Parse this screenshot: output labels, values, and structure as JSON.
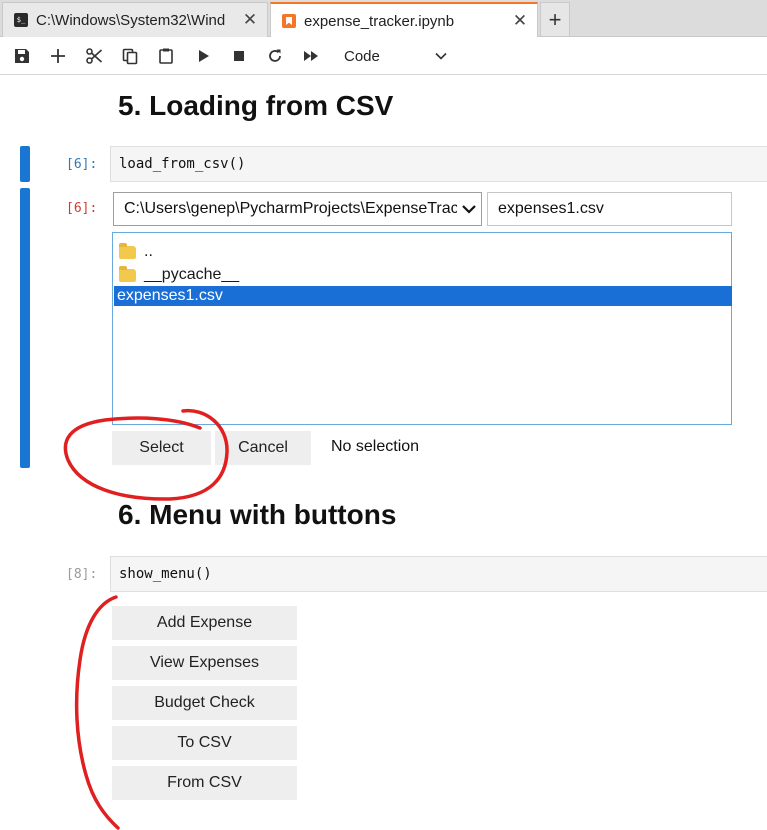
{
  "tabs": [
    {
      "label": "C:\\Windows\\System32\\Wind",
      "icon": "terminal-icon",
      "close": "✕"
    },
    {
      "label": "expense_tracker.ipynb",
      "icon": "notebook-icon",
      "close": "✕"
    }
  ],
  "new_tab": "+",
  "toolbar": {
    "buttons": [
      "save-icon",
      "add-cell-icon",
      "cut-icon",
      "copy-icon",
      "paste-icon",
      "run-icon",
      "stop-icon",
      "restart-icon",
      "fast-forward-icon"
    ],
    "cell_type": "Code"
  },
  "section5": {
    "heading": "5. Loading from CSV",
    "in_prompt": "[6]:",
    "code": "load_from_csv()",
    "out_prompt": "[6]:",
    "chooser": {
      "path": "C:\\Users\\genep\\PycharmProjects\\ExpenseTracker",
      "filename": "expenses1.csv",
      "entries": [
        "..",
        "__pycache__",
        "expenses1.csv"
      ],
      "selected": "expenses1.csv",
      "select_label": "Select",
      "cancel_label": "Cancel",
      "status": "No selection"
    }
  },
  "section6": {
    "heading": "6. Menu with buttons",
    "in_prompt": "[8]:",
    "code": "show_menu()",
    "buttons": [
      "Add Expense",
      "View Expenses",
      "Budget Check",
      "To CSV",
      "From CSV"
    ]
  },
  "colors": {
    "accent_blue": "#1976d2",
    "selection_blue": "#1a6fd6",
    "annotation_red": "#e02020",
    "notebook_orange": "#f37726"
  }
}
